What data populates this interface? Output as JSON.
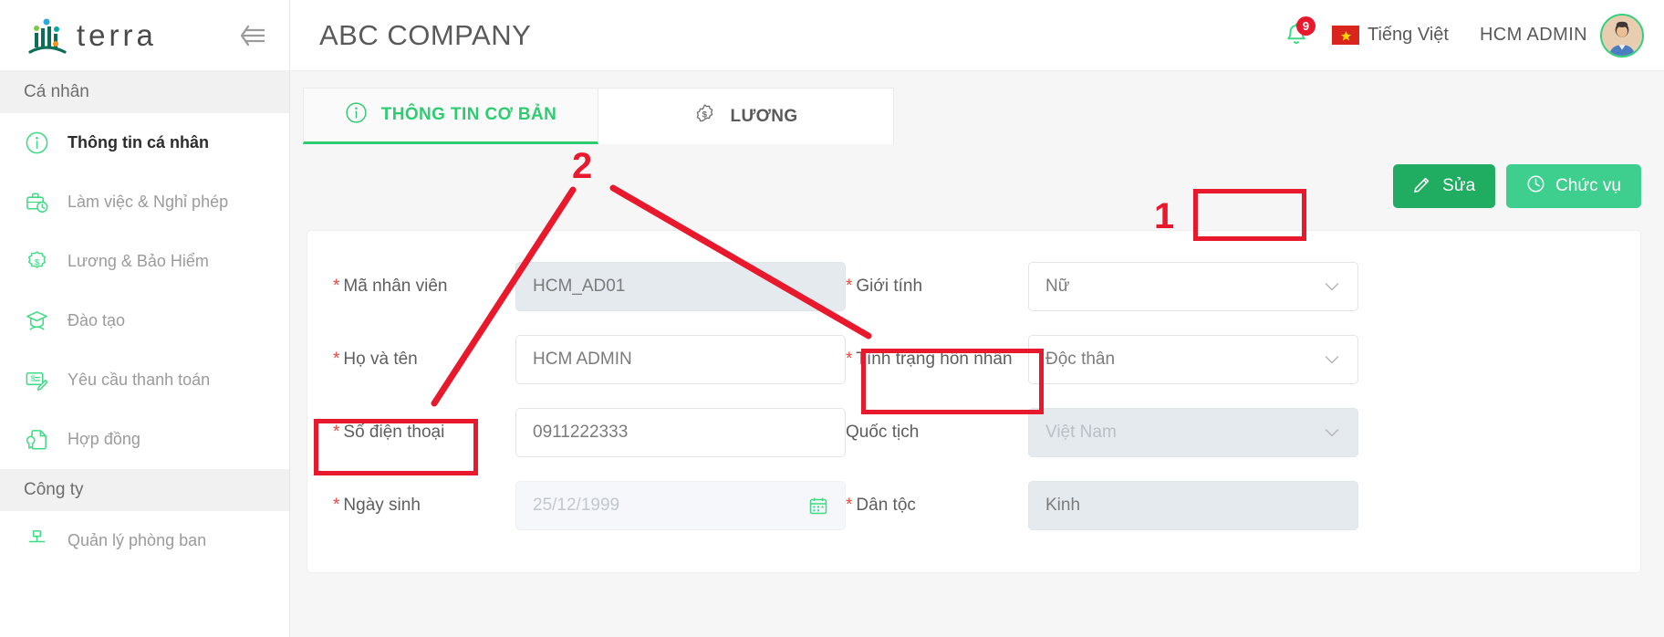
{
  "sidebar": {
    "brand": "terra",
    "collapse_icon": "collapse-menu-icon",
    "sections": [
      {
        "title": "Cá nhân",
        "items": [
          {
            "label": "Thông tin cá nhân",
            "icon": "info-circle-icon",
            "active": true
          },
          {
            "label": "Làm việc & Nghỉ phép",
            "icon": "briefcase-clock-icon",
            "active": false
          },
          {
            "label": "Lương & Bảo Hiểm",
            "icon": "dollar-badge-icon",
            "active": false
          },
          {
            "label": "Đào tạo",
            "icon": "graduation-cap-icon",
            "active": false
          },
          {
            "label": "Yêu cầu thanh toán",
            "icon": "invoice-edit-icon",
            "active": false
          },
          {
            "label": "Hợp đồng",
            "icon": "contract-seal-icon",
            "active": false
          }
        ]
      },
      {
        "title": "Công ty",
        "items": [
          {
            "label": "Quản lý phòng ban",
            "icon": "org-node-icon",
            "active": false
          }
        ]
      }
    ]
  },
  "header": {
    "company": "ABC COMPANY",
    "notification_icon": "bell-icon",
    "notification_count": "9",
    "flag_icon": "vietnam-flag-icon",
    "language": "Tiếng Việt",
    "user_name": "HCM ADMIN",
    "avatar_icon": "user-avatar"
  },
  "tabs": [
    {
      "label": "THÔNG TIN CƠ BẢN",
      "icon": "info-circle-icon",
      "active": true
    },
    {
      "label": "LƯƠNG",
      "icon": "dollar-badge-icon",
      "active": false
    }
  ],
  "actions": {
    "edit_label": "Sửa",
    "edit_icon": "pencil-icon",
    "role_label": "Chức vụ",
    "role_icon": "clock-icon"
  },
  "form": {
    "left": [
      {
        "label": "Mã nhân viên",
        "required": true,
        "value": "HCM_AD01",
        "state": "disabled",
        "control": "text"
      },
      {
        "label": "Họ và tên",
        "required": true,
        "value": "HCM ADMIN",
        "state": "normal",
        "control": "text"
      },
      {
        "label": "Số điện thoại",
        "required": true,
        "value": "0911222333",
        "state": "normal",
        "control": "text"
      },
      {
        "label": "Ngày sinh",
        "required": true,
        "value": "25/12/1999",
        "state": "disabled-light",
        "control": "date"
      }
    ],
    "right": [
      {
        "label": "Giới tính",
        "required": true,
        "value": "Nữ",
        "state": "normal",
        "control": "select"
      },
      {
        "label": "Tình trạng hôn nhân",
        "required": true,
        "value": "Độc thân",
        "state": "normal",
        "control": "select"
      },
      {
        "label": "Quốc tịch",
        "required": false,
        "value": "Việt Nam",
        "state": "disabled-soft",
        "control": "select"
      },
      {
        "label": "Dân tộc",
        "required": true,
        "value": "Kinh",
        "state": "disabled",
        "control": "text"
      }
    ]
  },
  "annotations": {
    "marker_1": "1",
    "marker_2": "2",
    "accent_red": "#e8192c"
  },
  "colors": {
    "brand_green": "#2ecc71",
    "btn_edit_green": "#20ad62",
    "btn_role_green": "#3ecf8e",
    "required_red": "#f4433c",
    "badge_red": "#e8192c"
  }
}
